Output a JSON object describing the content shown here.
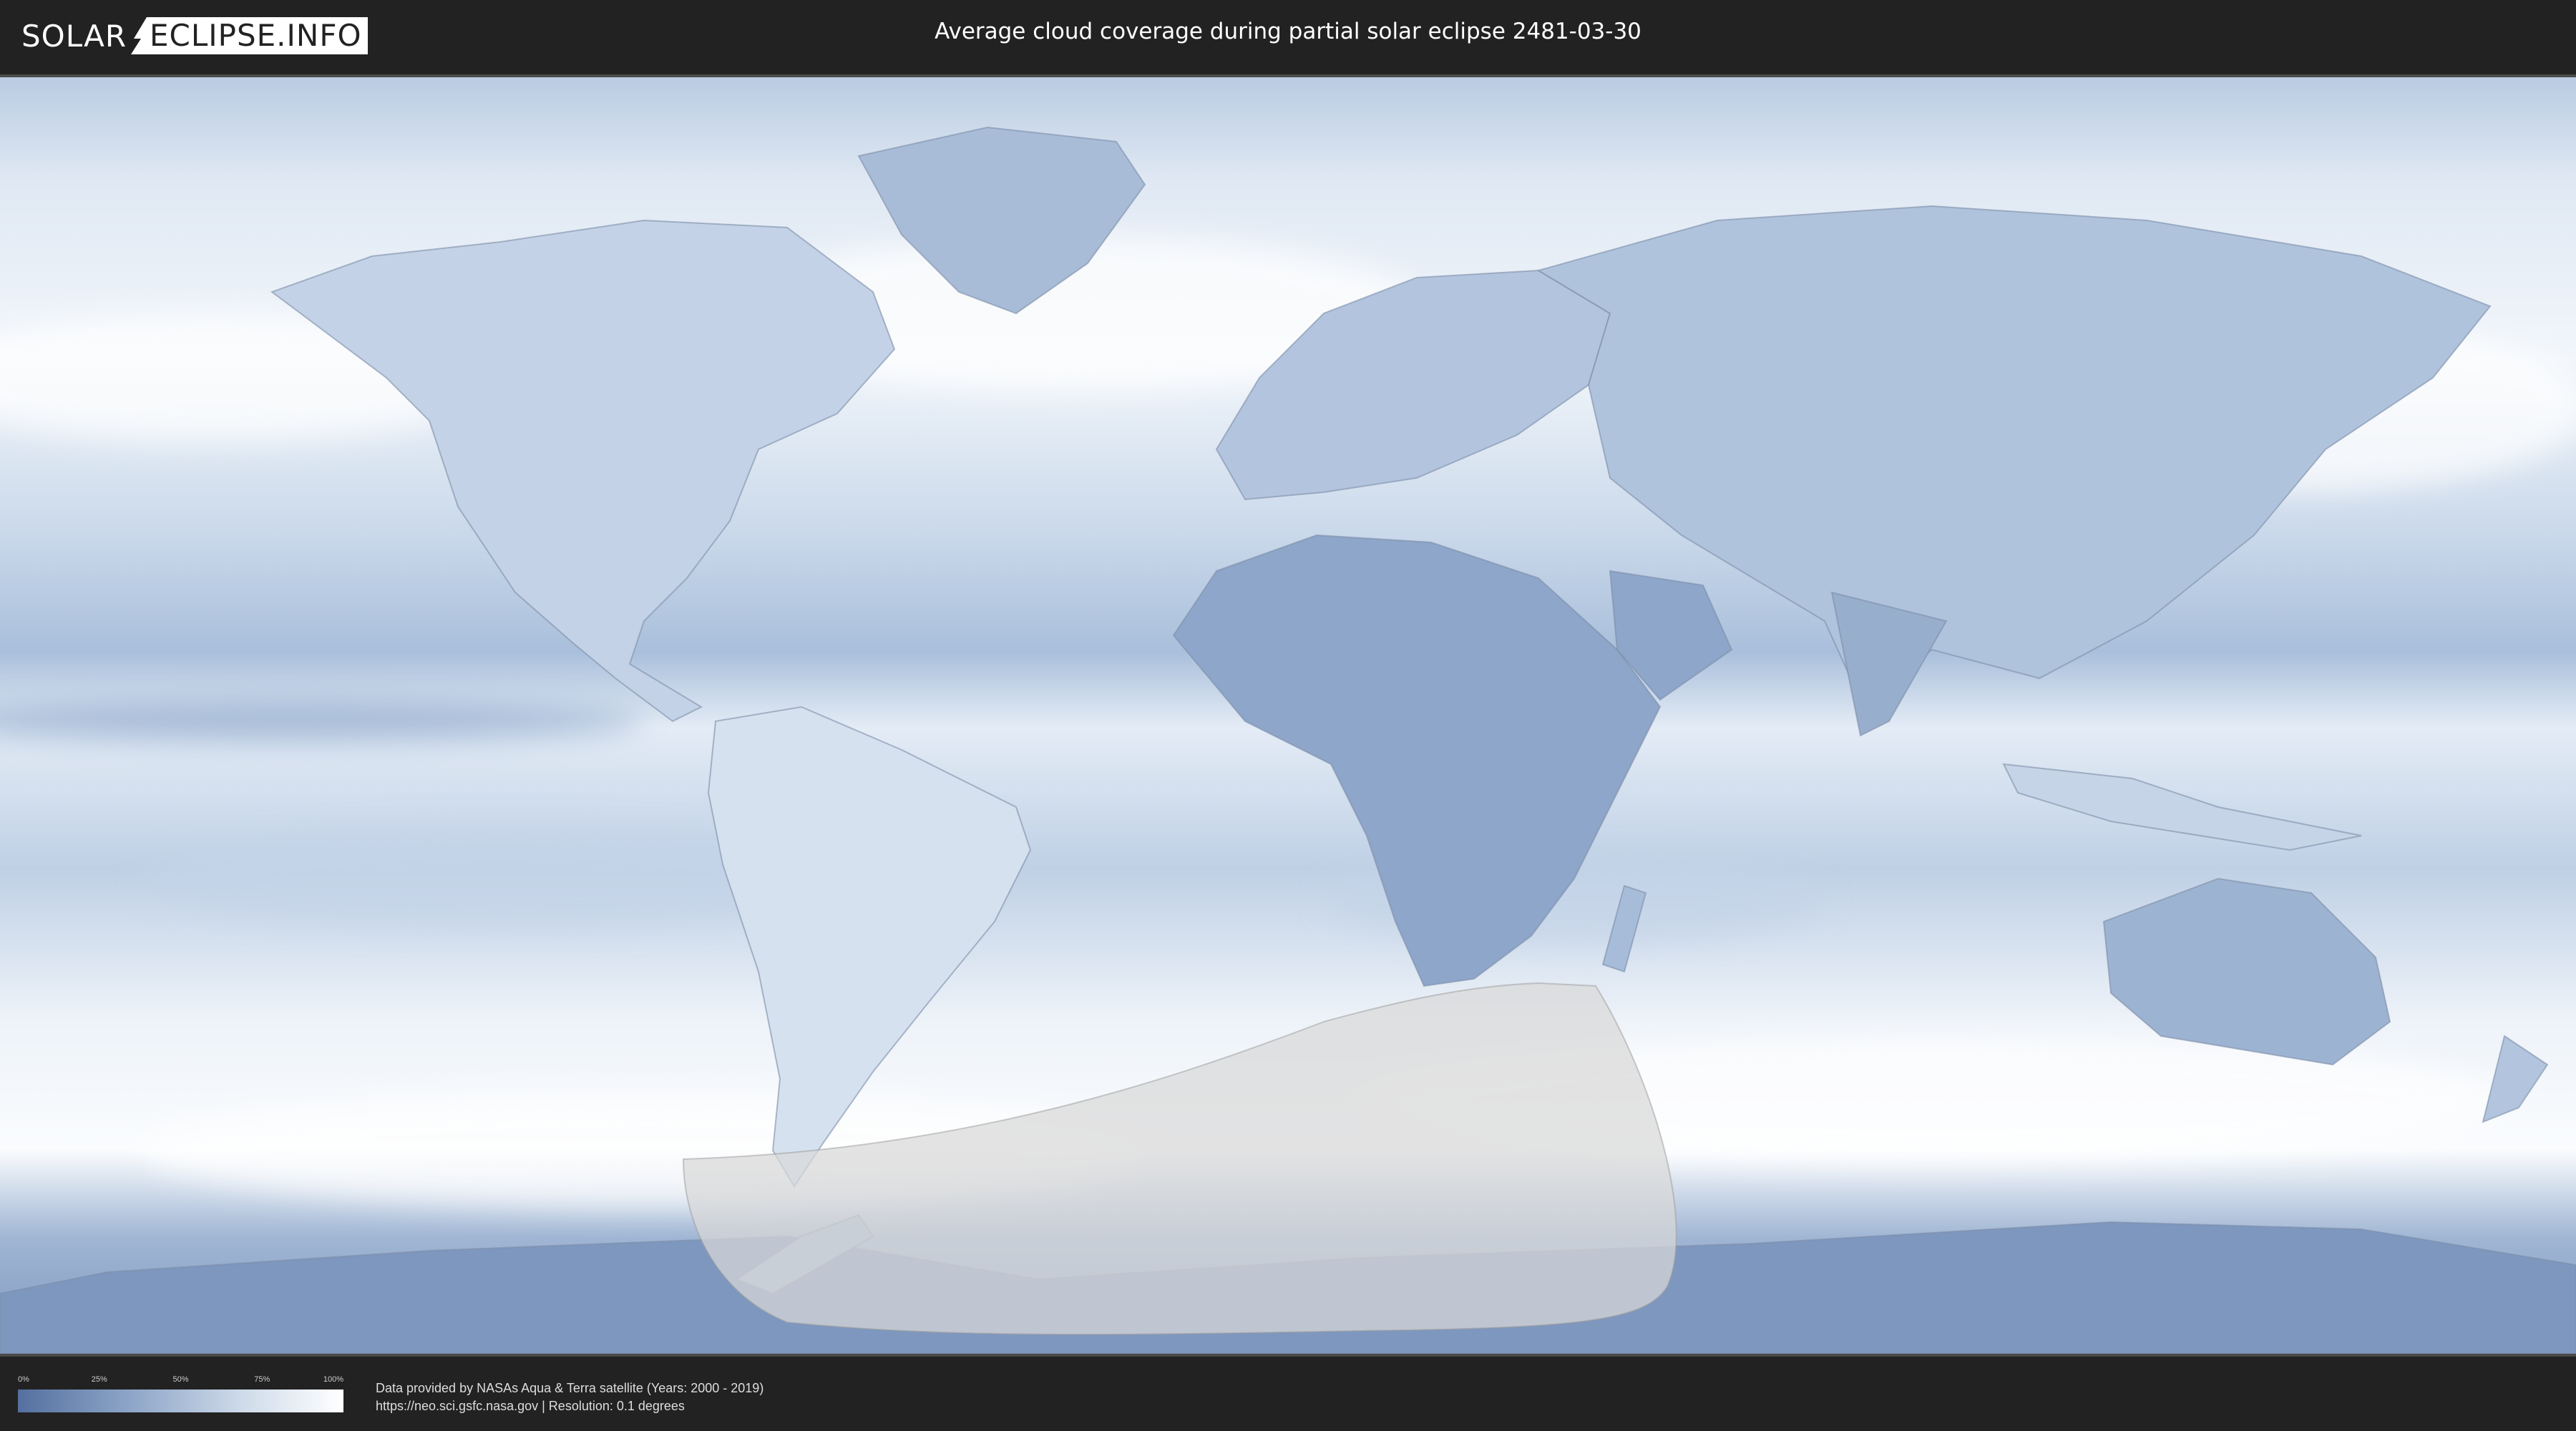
{
  "header": {
    "logo_left": "SOLAR",
    "logo_right": "ECLIPSE.INFO",
    "title": "Average cloud coverage during partial solar eclipse 2481-03-30"
  },
  "legend": {
    "ticks": [
      "0%",
      "25%",
      "50%",
      "75%",
      "100%"
    ],
    "tick_values": [
      0,
      25,
      50,
      75,
      100
    ],
    "colors": {
      "low": "#5570a0",
      "high": "#ffffff"
    }
  },
  "footer": {
    "source_line1": "Data provided by NASAs Aqua & Terra satellite (Years: 2000 - 2019)",
    "source_line2": "https://neo.sci.gsfc.nasa.gov | Resolution: 0.1 degrees"
  },
  "map": {
    "projection": "equirectangular",
    "eclipse_visibility_region": "South Atlantic, southern Africa and Antarctica",
    "colors": {
      "ocean_cloud": "#e6eef7",
      "clear_sky": "#6f89b5",
      "eclipse_overlay": "#d8d8d8"
    }
  }
}
